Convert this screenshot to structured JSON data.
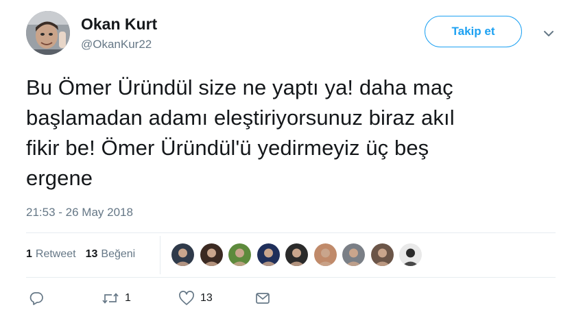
{
  "user": {
    "display_name": "Okan Kurt",
    "handle": "@OkanKur22",
    "avatar_icon": "profile-photo"
  },
  "follow_button": {
    "label": "Takip et"
  },
  "menu": {
    "icon": "chevron-down-icon"
  },
  "tweet": {
    "lines": [
      "Bu Ömer Üründül size ne yaptı ya! daha maç",
      "başlamadan adamı eleştiriyorsunuz biraz akıl",
      "fikir be! Ömer Üründül'ü yedirmeyiz üç beş",
      "ergene"
    ],
    "timestamp": "21:53 - 26 May 2018"
  },
  "stats": {
    "retweet_count": "1",
    "retweet_label": "Retweet",
    "like_count": "13",
    "like_label": "Beğeni"
  },
  "likers": [
    {
      "name": "liker-avatar-1",
      "color": "#2f3a4a"
    },
    {
      "name": "liker-avatar-2",
      "color": "#3b2a22"
    },
    {
      "name": "liker-avatar-3",
      "color": "#5d8a3c"
    },
    {
      "name": "liker-avatar-4",
      "color": "#1f2f5a"
    },
    {
      "name": "liker-avatar-5",
      "color": "#2a2a2a"
    },
    {
      "name": "liker-avatar-6",
      "color": "#c08a6a"
    },
    {
      "name": "liker-avatar-7",
      "color": "#7a7f86"
    },
    {
      "name": "liker-avatar-8",
      "color": "#6b5548"
    },
    {
      "name": "liker-avatar-9",
      "color": "#e9e9e9"
    }
  ],
  "actions": {
    "reply_icon": "reply-icon",
    "retweet_icon": "retweet-icon",
    "retweet_count": "1",
    "like_icon": "heart-icon",
    "like_count": "13",
    "dm_icon": "envelope-icon"
  },
  "colors": {
    "accent": "#1da1f2",
    "text": "#14171a",
    "secondary": "#657786",
    "divider": "#e6ecf0"
  }
}
